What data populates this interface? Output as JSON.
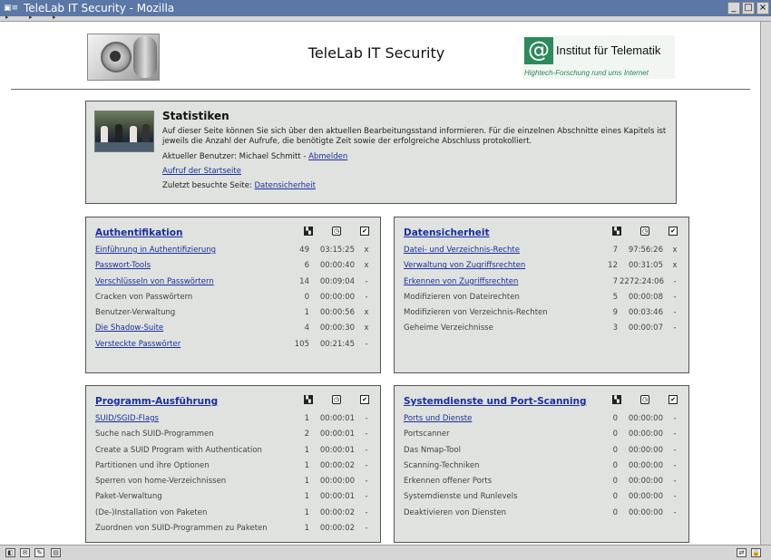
{
  "window": {
    "title": "TeleLab IT Security - Mozilla",
    "controls": {
      "minimize": "_",
      "maximize": "□",
      "close": "×"
    }
  },
  "header": {
    "site_title": "TeleLab IT Security",
    "institute_name": "Institut für Telematik",
    "institute_slogan": "Hightech-Forschung rund ums Internet",
    "logo_symbol": "@"
  },
  "stats": {
    "heading": "Statistiken",
    "description": "Auf dieser Seite können Sie sich über den aktuellen Bearbeitungsstand informieren. Für die einzelnen Abschnitte eines Kapitels ist jeweils die Anzahl der Aufrufe, die benötigte Zeit sowie der erfolgreiche Abschluss protokolliert.",
    "user_label": "Aktueller Benutzer: Michael Schmitt - ",
    "logout_link": "Abmelden",
    "start_link": "Aufruf der Startseite",
    "last_page_label": "Zuletzt besuchte Seite: ",
    "last_page_link": "Datensicherheit"
  },
  "panels": [
    {
      "title": "Authentifikation",
      "rows": [
        {
          "name": "Einführung in Authentifizierung",
          "link": true,
          "count": "49",
          "time": "03:15:25",
          "done": "x"
        },
        {
          "name": "Passwort-Tools",
          "link": true,
          "count": "6",
          "time": "00:00:40",
          "done": "x"
        },
        {
          "name": "Verschlüsseln von Passwörtern",
          "link": true,
          "count": "14",
          "time": "00:09:04",
          "done": "-"
        },
        {
          "name": "Cracken von Passwörtern",
          "link": false,
          "count": "0",
          "time": "00:00:00",
          "done": "-"
        },
        {
          "name": "Benutzer-Verwaltung",
          "link": false,
          "count": "1",
          "time": "00:00:56",
          "done": "x"
        },
        {
          "name": "Die Shadow-Suite",
          "link": true,
          "count": "4",
          "time": "00:00:30",
          "done": "x"
        },
        {
          "name": "Versteckte Passwörter",
          "link": true,
          "count": "105",
          "time": "00:21:45",
          "done": "-"
        }
      ]
    },
    {
      "title": "Datensicherheit",
      "rows": [
        {
          "name": "Datei- und Verzeichnis-Rechte",
          "link": true,
          "count": "7",
          "time": "97:56:26",
          "done": "x"
        },
        {
          "name": "Verwaltung von Zugriffsrechten",
          "link": true,
          "count": "12",
          "time": "00:31:05",
          "done": "x"
        },
        {
          "name": "Erkennen von Zugriffsrechten",
          "link": true,
          "count": "7",
          "time": "2272:24:06",
          "done": "-"
        },
        {
          "name": "Modifizieren von Dateirechten",
          "link": false,
          "count": "5",
          "time": "00:00:08",
          "done": "-"
        },
        {
          "name": "Modifizieren von Verzeichnis-Rechten",
          "link": false,
          "count": "9",
          "time": "00:03:46",
          "done": "-"
        },
        {
          "name": "Geheime Verzeichnisse",
          "link": false,
          "count": "3",
          "time": "00:00:07",
          "done": "-"
        }
      ]
    },
    {
      "title": "Programm-Ausführung",
      "rows": [
        {
          "name": "SUID/SGID-Flags",
          "link": true,
          "count": "1",
          "time": "00:00:01",
          "done": "-"
        },
        {
          "name": "Suche nach SUID-Programmen",
          "link": false,
          "count": "2",
          "time": "00:00:01",
          "done": "-"
        },
        {
          "name": "Create a SUID Program with Authentication",
          "link": false,
          "count": "1",
          "time": "00:00:01",
          "done": "-"
        },
        {
          "name": "Partitionen und ihre Optionen",
          "link": false,
          "count": "1",
          "time": "00:00:02",
          "done": "-"
        },
        {
          "name": "Sperren von home-Verzeichnissen",
          "link": false,
          "count": "1",
          "time": "00:00:00",
          "done": "-"
        },
        {
          "name": "Paket-Verwaltung",
          "link": false,
          "count": "1",
          "time": "00:00:01",
          "done": "-"
        },
        {
          "name": "(De-)Installation von Paketen",
          "link": false,
          "count": "1",
          "time": "00:00:02",
          "done": "-"
        },
        {
          "name": "Zuordnen von SUID-Programmen zu Paketen",
          "link": false,
          "count": "1",
          "time": "00:00:02",
          "done": "-"
        }
      ]
    },
    {
      "title": "Systemdienste und Port-Scanning",
      "rows": [
        {
          "name": "Ports und Dienste",
          "link": true,
          "count": "0",
          "time": "00:00:00",
          "done": "-"
        },
        {
          "name": "Portscanner",
          "link": false,
          "count": "0",
          "time": "00:00:00",
          "done": "-"
        },
        {
          "name": "Das Nmap-Tool",
          "link": false,
          "count": "0",
          "time": "00:00:00",
          "done": "-"
        },
        {
          "name": "Scanning-Techniken",
          "link": false,
          "count": "0",
          "time": "00:00:00",
          "done": "-"
        },
        {
          "name": "Erkennen offener Ports",
          "link": false,
          "count": "0",
          "time": "00:00:00",
          "done": "-"
        },
        {
          "name": "Systemdienste und Runlevels",
          "link": false,
          "count": "0",
          "time": "00:00:00",
          "done": "-"
        },
        {
          "name": "Deaktivieren von Diensten",
          "link": false,
          "count": "0",
          "time": "00:00:00",
          "done": "-"
        }
      ]
    }
  ],
  "column_icons": {
    "visits": "visits-icon",
    "time": "clock-icon",
    "done": "checkbox-icon"
  },
  "colors": {
    "panel_bg": "#dfe2de",
    "link": "#1a2fa0",
    "titlebar": "#5a77a6",
    "logo_green": "#2d8a5e"
  }
}
